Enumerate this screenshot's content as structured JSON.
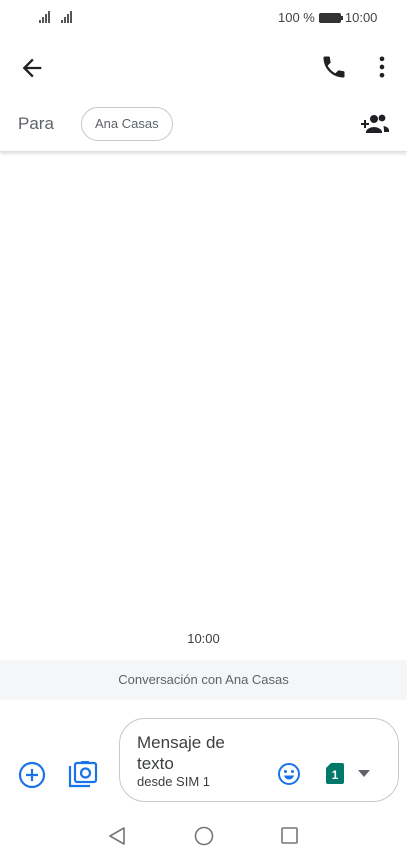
{
  "status_bar": {
    "battery_percent": "100 %",
    "time": "10:00"
  },
  "app_bar": {
    "back_icon": "arrow-back-icon",
    "call_icon": "phone-icon",
    "more_icon": "more-vert-icon"
  },
  "recipient": {
    "label": "Para",
    "chip": "Ana Casas",
    "add_icon": "add-person-icon"
  },
  "conversation": {
    "timestamp": "10:00",
    "info": "Conversación con Ana Casas"
  },
  "compose": {
    "placeholder": "Mensaje de texto",
    "sim_label": "desde SIM 1",
    "sim_number": "1",
    "add_icon": "add-circle-icon",
    "gallery_icon": "gallery-camera-icon",
    "emoji_icon": "emoji-icon"
  },
  "colors": {
    "accent": "#1a73e8",
    "sim": "#00796b",
    "icon": "#202124"
  }
}
